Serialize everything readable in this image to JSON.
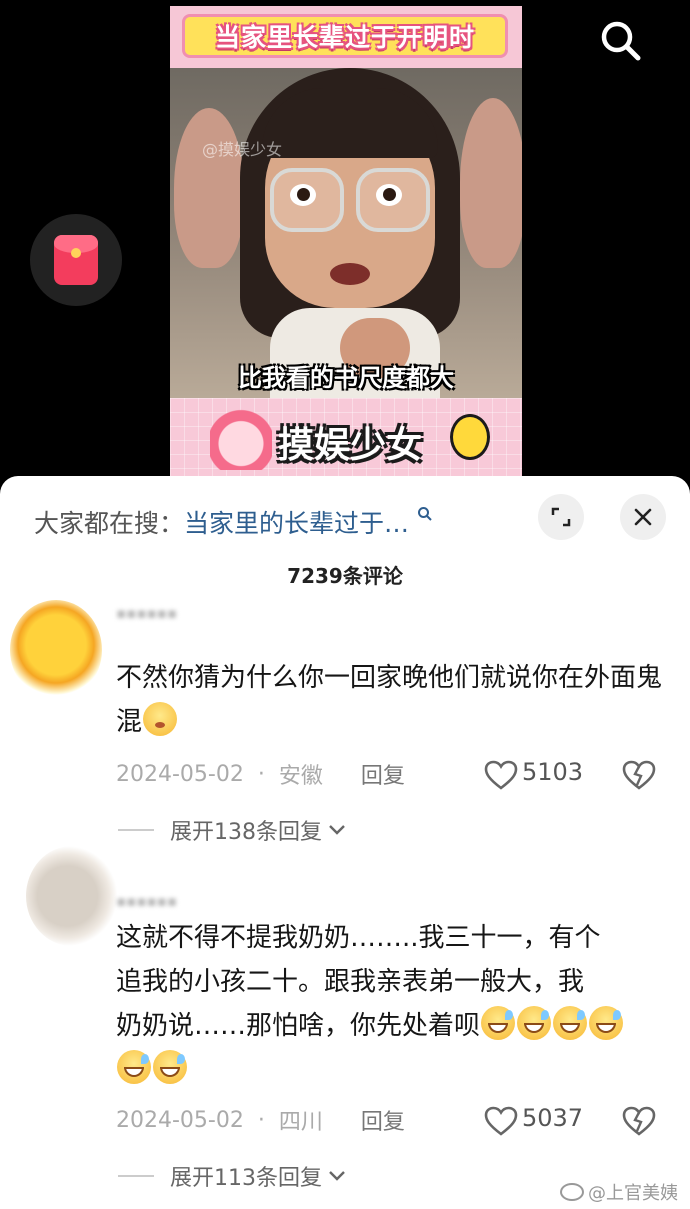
{
  "video": {
    "title_banner": "当家里长辈过于开明时",
    "watermark": "@摸娱少女",
    "caption": "比我看的书尺度都大",
    "brand": "摸娱少女"
  },
  "sheet": {
    "search_prefix": "大家都在搜：",
    "search_query": "当家里的长辈过于…",
    "comment_count": "7239条评论"
  },
  "comments": [
    {
      "text": "不然你猜为什么你一回家晚他们就说你在外面鬼混",
      "date": "2024-05-02",
      "location": "安徽",
      "reply_label": "回复",
      "likes": "5103",
      "expand_label": "展开138条回复"
    },
    {
      "text_line1": "这就不得不提我奶奶……..我三十一，有个",
      "text_line2": "追我的小孩二十。跟我亲表弟一般大，我",
      "text_line3": "奶奶说……那怕啥，你先处着呗",
      "date": "2024-05-02",
      "location": "四川",
      "reply_label": "回复",
      "likes": "5037",
      "expand_label": "展开113条回复"
    }
  ],
  "footer_watermark": "@上官美姨",
  "icons": {
    "search": "search-icon",
    "red_packet": "red-packet-icon",
    "expand": "expand-icon",
    "close": "close-icon",
    "like": "heart-icon",
    "dislike": "broken-heart-icon"
  },
  "colors": {
    "search_query": "#2e5e8f",
    "banner_pink": "#e6537f",
    "red_packet": "#f33d5d"
  }
}
